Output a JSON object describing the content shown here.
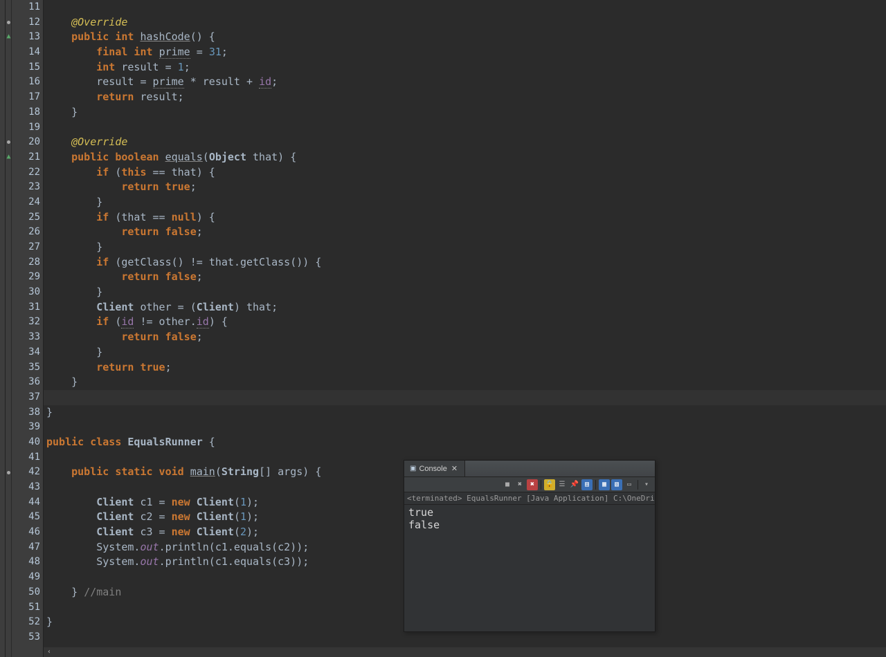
{
  "editor": {
    "startLine": 11,
    "currentLine": 37,
    "markers": {
      "13": "green-triangle",
      "21": "green-triangle",
      "12": "dot",
      "20": "dot",
      "42": "dot"
    },
    "lines": [
      {
        "n": 11,
        "tokens": []
      },
      {
        "n": 12,
        "tokens": [
          {
            "c": "ann-txt",
            "t": "    @Override"
          }
        ]
      },
      {
        "n": 13,
        "tokens": [
          {
            "c": "",
            "t": "    "
          },
          {
            "c": "kw",
            "t": "public int"
          },
          {
            "c": "",
            "t": " "
          },
          {
            "c": "mname under",
            "t": "hashCode"
          },
          {
            "c": "",
            "t": "() {"
          }
        ]
      },
      {
        "n": 14,
        "tokens": [
          {
            "c": "",
            "t": "        "
          },
          {
            "c": "kw",
            "t": "final int"
          },
          {
            "c": "",
            "t": " "
          },
          {
            "c": "param dot-under",
            "t": "prime"
          },
          {
            "c": "",
            "t": " = "
          },
          {
            "c": "num",
            "t": "31"
          },
          {
            "c": "",
            "t": ";"
          }
        ]
      },
      {
        "n": 15,
        "tokens": [
          {
            "c": "",
            "t": "        "
          },
          {
            "c": "kw",
            "t": "int"
          },
          {
            "c": "",
            "t": " result = "
          },
          {
            "c": "num",
            "t": "1"
          },
          {
            "c": "",
            "t": ";"
          }
        ]
      },
      {
        "n": 16,
        "tokens": [
          {
            "c": "",
            "t": "        result = "
          },
          {
            "c": "param dot-under",
            "t": "prime"
          },
          {
            "c": "",
            "t": " * result + "
          },
          {
            "c": "field dot-under",
            "t": "id"
          },
          {
            "c": "",
            "t": ";"
          }
        ]
      },
      {
        "n": 17,
        "tokens": [
          {
            "c": "",
            "t": "        "
          },
          {
            "c": "kw",
            "t": "return"
          },
          {
            "c": "",
            "t": " result;"
          }
        ]
      },
      {
        "n": 18,
        "tokens": [
          {
            "c": "",
            "t": "    }"
          }
        ]
      },
      {
        "n": 19,
        "tokens": []
      },
      {
        "n": 20,
        "tokens": [
          {
            "c": "ann-txt",
            "t": "    @Override"
          }
        ]
      },
      {
        "n": 21,
        "tokens": [
          {
            "c": "",
            "t": "    "
          },
          {
            "c": "kw",
            "t": "public boolean"
          },
          {
            "c": "",
            "t": " "
          },
          {
            "c": "mname under",
            "t": "equals"
          },
          {
            "c": "",
            "t": "("
          },
          {
            "c": "cls",
            "t": "Object"
          },
          {
            "c": "",
            "t": " "
          },
          {
            "c": "param",
            "t": "that"
          },
          {
            "c": "",
            "t": ") {"
          }
        ]
      },
      {
        "n": 22,
        "tokens": [
          {
            "c": "",
            "t": "        "
          },
          {
            "c": "kw",
            "t": "if"
          },
          {
            "c": "",
            "t": " ("
          },
          {
            "c": "kw",
            "t": "this"
          },
          {
            "c": "",
            "t": " == "
          },
          {
            "c": "param",
            "t": "that"
          },
          {
            "c": "",
            "t": ") {"
          }
        ]
      },
      {
        "n": 23,
        "tokens": [
          {
            "c": "",
            "t": "            "
          },
          {
            "c": "kw",
            "t": "return true"
          },
          {
            "c": "",
            "t": ";"
          }
        ]
      },
      {
        "n": 24,
        "tokens": [
          {
            "c": "",
            "t": "        }"
          }
        ]
      },
      {
        "n": 25,
        "tokens": [
          {
            "c": "",
            "t": "        "
          },
          {
            "c": "kw",
            "t": "if"
          },
          {
            "c": "",
            "t": " ("
          },
          {
            "c": "param",
            "t": "that"
          },
          {
            "c": "",
            "t": " == "
          },
          {
            "c": "kw",
            "t": "null"
          },
          {
            "c": "",
            "t": ") {"
          }
        ]
      },
      {
        "n": 26,
        "tokens": [
          {
            "c": "",
            "t": "            "
          },
          {
            "c": "kw",
            "t": "return false"
          },
          {
            "c": "",
            "t": ";"
          }
        ]
      },
      {
        "n": 27,
        "tokens": [
          {
            "c": "",
            "t": "        }"
          }
        ]
      },
      {
        "n": 28,
        "tokens": [
          {
            "c": "",
            "t": "        "
          },
          {
            "c": "kw",
            "t": "if"
          },
          {
            "c": "",
            "t": " (getClass() != "
          },
          {
            "c": "param",
            "t": "that"
          },
          {
            "c": "",
            "t": ".getClass()) {"
          }
        ]
      },
      {
        "n": 29,
        "tokens": [
          {
            "c": "",
            "t": "            "
          },
          {
            "c": "kw",
            "t": "return false"
          },
          {
            "c": "",
            "t": ";"
          }
        ]
      },
      {
        "n": 30,
        "tokens": [
          {
            "c": "",
            "t": "        }"
          }
        ]
      },
      {
        "n": 31,
        "tokens": [
          {
            "c": "",
            "t": "        "
          },
          {
            "c": "cls",
            "t": "Client"
          },
          {
            "c": "",
            "t": " other = ("
          },
          {
            "c": "cls",
            "t": "Client"
          },
          {
            "c": "",
            "t": ") "
          },
          {
            "c": "param",
            "t": "that"
          },
          {
            "c": "",
            "t": ";"
          }
        ]
      },
      {
        "n": 32,
        "tokens": [
          {
            "c": "",
            "t": "        "
          },
          {
            "c": "kw",
            "t": "if"
          },
          {
            "c": "",
            "t": " ("
          },
          {
            "c": "field dot-under",
            "t": "id"
          },
          {
            "c": "",
            "t": " != other."
          },
          {
            "c": "field dot-under",
            "t": "id"
          },
          {
            "c": "",
            "t": ") {"
          }
        ]
      },
      {
        "n": 33,
        "tokens": [
          {
            "c": "",
            "t": "            "
          },
          {
            "c": "kw",
            "t": "return false"
          },
          {
            "c": "",
            "t": ";"
          }
        ]
      },
      {
        "n": 34,
        "tokens": [
          {
            "c": "",
            "t": "        }"
          }
        ]
      },
      {
        "n": 35,
        "tokens": [
          {
            "c": "",
            "t": "        "
          },
          {
            "c": "kw",
            "t": "return true"
          },
          {
            "c": "",
            "t": ";"
          }
        ]
      },
      {
        "n": 36,
        "tokens": [
          {
            "c": "",
            "t": "    }"
          }
        ]
      },
      {
        "n": 37,
        "tokens": []
      },
      {
        "n": 38,
        "tokens": [
          {
            "c": "",
            "t": "}"
          }
        ]
      },
      {
        "n": 39,
        "tokens": []
      },
      {
        "n": 40,
        "tokens": [
          {
            "c": "kw",
            "t": "public class"
          },
          {
            "c": "",
            "t": " "
          },
          {
            "c": "cls",
            "t": "EqualsRunner"
          },
          {
            "c": "",
            "t": " {"
          }
        ]
      },
      {
        "n": 41,
        "tokens": []
      },
      {
        "n": 42,
        "tokens": [
          {
            "c": "",
            "t": "    "
          },
          {
            "c": "kw",
            "t": "public static void"
          },
          {
            "c": "",
            "t": " "
          },
          {
            "c": "mname under",
            "t": "main"
          },
          {
            "c": "",
            "t": "("
          },
          {
            "c": "cls",
            "t": "String"
          },
          {
            "c": "",
            "t": "[] "
          },
          {
            "c": "param",
            "t": "args"
          },
          {
            "c": "",
            "t": ") {"
          }
        ]
      },
      {
        "n": 43,
        "tokens": []
      },
      {
        "n": 44,
        "tokens": [
          {
            "c": "",
            "t": "        "
          },
          {
            "c": "cls",
            "t": "Client"
          },
          {
            "c": "",
            "t": " c1 = "
          },
          {
            "c": "kw",
            "t": "new"
          },
          {
            "c": "",
            "t": " "
          },
          {
            "c": "cls",
            "t": "Client"
          },
          {
            "c": "",
            "t": "("
          },
          {
            "c": "num",
            "t": "1"
          },
          {
            "c": "",
            "t": ");"
          }
        ]
      },
      {
        "n": 45,
        "tokens": [
          {
            "c": "",
            "t": "        "
          },
          {
            "c": "cls",
            "t": "Client"
          },
          {
            "c": "",
            "t": " c2 = "
          },
          {
            "c": "kw",
            "t": "new"
          },
          {
            "c": "",
            "t": " "
          },
          {
            "c": "cls",
            "t": "Client"
          },
          {
            "c": "",
            "t": "("
          },
          {
            "c": "num",
            "t": "1"
          },
          {
            "c": "",
            "t": ");"
          }
        ]
      },
      {
        "n": 46,
        "tokens": [
          {
            "c": "",
            "t": "        "
          },
          {
            "c": "cls",
            "t": "Client"
          },
          {
            "c": "",
            "t": " c3 = "
          },
          {
            "c": "kw",
            "t": "new"
          },
          {
            "c": "",
            "t": " "
          },
          {
            "c": "cls",
            "t": "Client"
          },
          {
            "c": "",
            "t": "("
          },
          {
            "c": "num",
            "t": "2"
          },
          {
            "c": "",
            "t": ");"
          }
        ]
      },
      {
        "n": 47,
        "tokens": [
          {
            "c": "",
            "t": "        System."
          },
          {
            "c": "statfld",
            "t": "out"
          },
          {
            "c": "",
            "t": ".println(c1.equals(c2));"
          }
        ]
      },
      {
        "n": 48,
        "tokens": [
          {
            "c": "",
            "t": "        System."
          },
          {
            "c": "statfld",
            "t": "out"
          },
          {
            "c": "",
            "t": ".println(c1.equals(c3));"
          }
        ]
      },
      {
        "n": 49,
        "tokens": []
      },
      {
        "n": 50,
        "tokens": [
          {
            "c": "",
            "t": "    } "
          },
          {
            "c": "com",
            "t": "//main"
          }
        ]
      },
      {
        "n": 51,
        "tokens": []
      },
      {
        "n": 52,
        "tokens": [
          {
            "c": "",
            "t": "}"
          }
        ]
      },
      {
        "n": 53,
        "tokens": []
      }
    ]
  },
  "console": {
    "tab_label": "Console",
    "status": "<terminated> EqualsRunner [Java Application] C:\\OneDrive\\class\\",
    "output": "true\nfalse",
    "toolbar_icons": [
      "stop",
      "remove",
      "remove-all",
      "|",
      "scroll-lock",
      "clear",
      "pin",
      "display",
      "|",
      "open",
      "new",
      "min",
      "|",
      "menu"
    ]
  }
}
